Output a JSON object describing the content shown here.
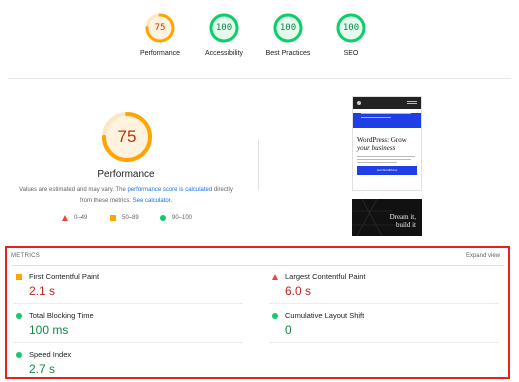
{
  "gauges": [
    {
      "score": "75",
      "label": "Performance",
      "status": "average",
      "fraction": 0.75
    },
    {
      "score": "100",
      "label": "Accessibility",
      "status": "pass",
      "fraction": 1.0
    },
    {
      "score": "100",
      "label": "Best Practices",
      "status": "pass",
      "fraction": 1.0
    },
    {
      "score": "100",
      "label": "SEO",
      "status": "pass",
      "fraction": 1.0
    }
  ],
  "performance": {
    "score": "75",
    "fraction": 0.75,
    "title": "Performance",
    "desc_part1": "Values are estimated and may vary. The ",
    "desc_link1": "performance score is calculated",
    "desc_part2": " directly from these metrics. ",
    "desc_link2": "See calculator."
  },
  "legend": {
    "fail": "0–49",
    "average": "50–89",
    "pass": "90–100"
  },
  "screenshot": {
    "headline_1": "WordPress: Grow",
    "headline_2": "your business",
    "button": "Get WordPress",
    "dark_line_1": "Dream it,",
    "dark_line_2": "build it"
  },
  "metrics": {
    "header": "METRICS",
    "expand": "Expand view",
    "items": [
      {
        "label": "First Contentful Paint",
        "value": "2.1 s",
        "status": "average"
      },
      {
        "label": "Largest Contentful Paint",
        "value": "6.0 s",
        "status": "fail"
      },
      {
        "label": "Total Blocking Time",
        "value": "100 ms",
        "status": "pass"
      },
      {
        "label": "Cumulative Layout Shift",
        "value": "0",
        "status": "pass"
      },
      {
        "label": "Speed Index",
        "value": "2.7 s",
        "status": "pass"
      }
    ]
  },
  "colors": {
    "average": "#ffa400",
    "pass": "#0cce6b",
    "fail": "#e8453c",
    "average_text": "#c33300",
    "pass_text": "#0d8a43",
    "highlight": "#e8221b"
  },
  "icons": {
    "average": "orange-square-icon",
    "pass": "green-circle-icon",
    "fail": "red-triangle-icon"
  }
}
